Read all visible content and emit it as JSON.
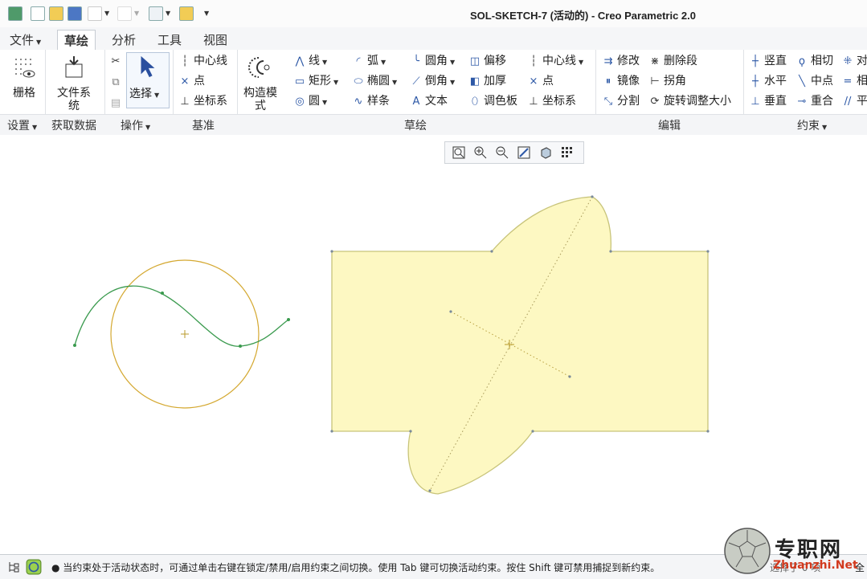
{
  "window": {
    "title": "SOL-SKETCH-7 (活动的) - Creo Parametric 2.0"
  },
  "tabs": [
    {
      "label": "文件",
      "has_dropdown": true
    },
    {
      "label": "草绘",
      "active": true
    },
    {
      "label": "分析"
    },
    {
      "label": "工具"
    },
    {
      "label": "视图"
    }
  ],
  "ribbon": {
    "grid": "栅格",
    "file_system": "文件系统",
    "select": "选择",
    "datum": {
      "centerline": "中心线",
      "point": "点",
      "coord": "坐标系"
    },
    "construction_mode": "构造模式",
    "sketch": {
      "line": "线",
      "rect": "矩形",
      "circle": "圆",
      "arc": "弧",
      "ellipse": "椭圆",
      "spline": "样条",
      "fillet": "圆角",
      "chamfer": "倒角",
      "text": "文本",
      "offset": "偏移",
      "thicken": "加厚",
      "palette": "调色板",
      "centerline": "中心线",
      "point": "点",
      "coord": "坐标系"
    },
    "edit": {
      "modify": "修改",
      "delete_seg": "删除段",
      "mirror": "镜像",
      "corner": "拐角",
      "divide": "分割",
      "rotate_resize": "旋转调整大小"
    },
    "constrain": {
      "vertical": "竖直",
      "tangent": "相切",
      "symmetric": "对",
      "horizontal": "水平",
      "midpoint": "中点",
      "equal": "相",
      "perpendicular": "垂直",
      "coincident": "重合",
      "parallel": "平"
    }
  },
  "groups": {
    "setup": "设置",
    "get_data": "获取数据",
    "operations": "操作",
    "datum": "基准",
    "sketching": "草绘",
    "editing": "编辑",
    "constrain": "约束"
  },
  "view_toolbar": [
    "zoom-fit-icon",
    "zoom-in-icon",
    "zoom-out-icon",
    "repaint-icon",
    "display-style-icon",
    "sketcher-display-icon"
  ],
  "status": {
    "message": "● 当约束处于活动状态时，可通过单击右键在锁定/禁用/启用约束之间切换。使用 Tab 键可切换活动约束。按住 Shift 键可禁用捕捉到新约束。",
    "right_text": "选择了 0 项",
    "right_end": "全"
  },
  "watermark": {
    "brand": "专职网",
    "site": "Zhuanzhi.Net"
  },
  "colors": {
    "shape_fill": "#fdf8c2",
    "shape_edge": "#c8c47a",
    "circle": "#d4a830",
    "spline": "#3a9a4e",
    "center": "#b89a2a"
  }
}
